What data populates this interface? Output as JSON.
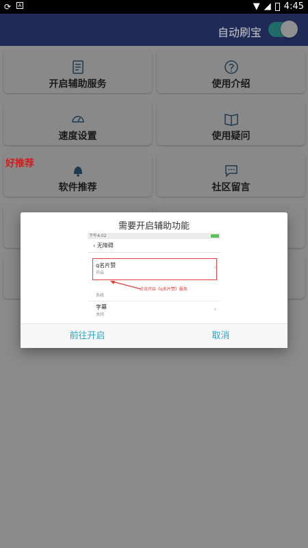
{
  "status_bar": {
    "time": "4:45",
    "left_icons": [
      "sync-icon",
      "a-icon"
    ],
    "right_icons": [
      "wifi-icon",
      "signal-icon",
      "battery-icon"
    ]
  },
  "header": {
    "toggle_label": "自动刷宝",
    "toggle_on": true
  },
  "grid": {
    "badge": "好推荐",
    "items": [
      {
        "label": "开启辅助服务",
        "icon": "keyboard-icon"
      },
      {
        "label": "使用介绍",
        "icon": "help-circle-icon"
      },
      {
        "label": "速度设置",
        "icon": "speedometer-icon"
      },
      {
        "label": "使用疑问",
        "icon": "book-icon"
      },
      {
        "label": "软件推荐",
        "icon": "bell-icon"
      },
      {
        "label": "社区留言",
        "icon": "chat-icon"
      }
    ]
  },
  "dialog": {
    "title": "需要开启辅助功能",
    "screenshot": {
      "status_time": "下午4:02",
      "nav_title": "无障碍",
      "rows": [
        {
          "title": "q名片赞",
          "sub": "开启"
        },
        {
          "title": "",
          "sub": "系统"
        },
        {
          "title": "字幕",
          "sub": "关闭"
        }
      ],
      "annotation": "点击开启《q名片赞》服务"
    },
    "confirm_label": "前往开启",
    "cancel_label": "取消"
  },
  "colors": {
    "header_bg": "#1f2a57",
    "accent": "#2aa6c9",
    "highlight": "#e23b3b",
    "badge": "#d31b1b"
  }
}
